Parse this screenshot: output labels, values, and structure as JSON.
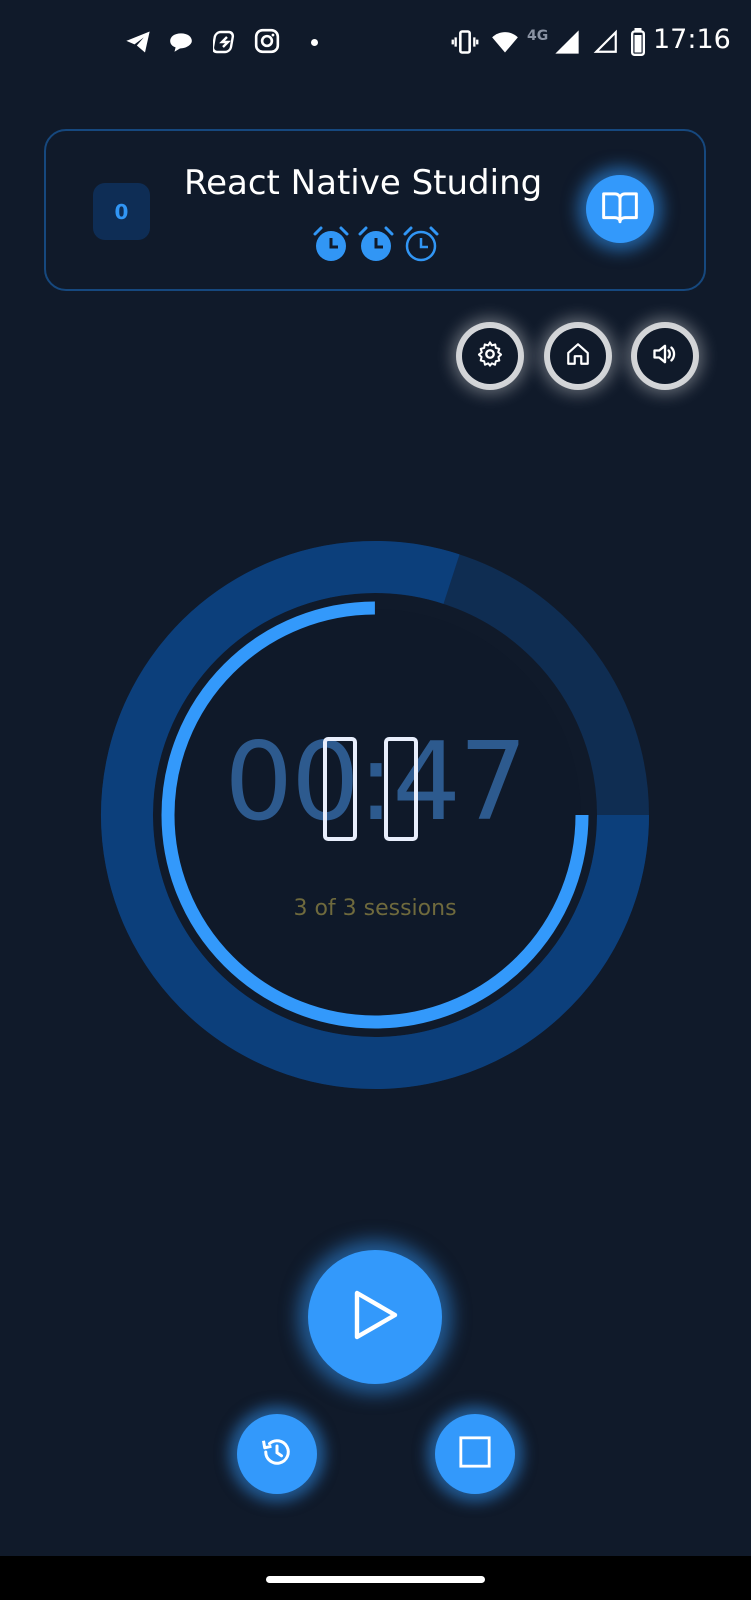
{
  "status_bar": {
    "time": "17:16",
    "network": "4G",
    "notification_icons": [
      "telegram-icon",
      "chat-bubble-icon",
      "shazam-icon",
      "instagram-icon",
      "dot-icon"
    ],
    "system_icons": [
      "vibrate-icon",
      "wifi-icon",
      "signal-icon",
      "signal-empty-icon",
      "battery-icon"
    ]
  },
  "task": {
    "count": "0",
    "title": "React Native Studing",
    "alarms_filled": 2,
    "alarms_total": 3
  },
  "controls": {
    "top": [
      "gear-icon",
      "home-icon",
      "speaker-icon"
    ]
  },
  "timer": {
    "time": "00:47",
    "sessions_label": "3 of 3 sessions",
    "outer_progress": 0.8,
    "inner_progress": 0.75
  },
  "colors": {
    "background": "#101a2a",
    "accent": "#3399fb",
    "ring_dark": "#0e3a6f",
    "ring_remaining": "#0f2d52"
  }
}
